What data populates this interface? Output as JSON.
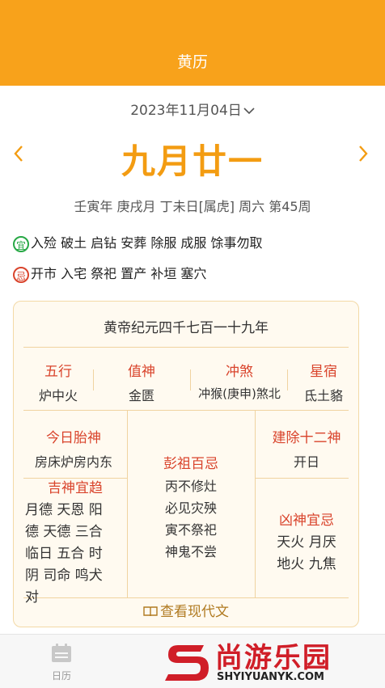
{
  "header": {
    "title": "黄历"
  },
  "date_selector": {
    "date": "2023年11月04日"
  },
  "lunar_date": "九月廿一",
  "ganzhi_line": "壬寅年 庚戌月 丁未日[属虎] 周六 第45周",
  "yi": {
    "badge": "宜",
    "text": "入殓 破土 启钻 安葬 除服 成服 馀事勿取"
  },
  "ji": {
    "badge": "忌",
    "text": "开市 入宅 祭祀 置产 补垣 塞穴"
  },
  "card": {
    "title": "黄帝纪元四千七百一十九年",
    "wuxing": {
      "label": "五行",
      "value": "炉中火"
    },
    "zhishen": {
      "label": "值神",
      "value": "金匮"
    },
    "chongsha": {
      "label": "冲煞",
      "value": "冲猴(庚申)煞北"
    },
    "xingsu": {
      "label": "星宿",
      "value": "氐土貉"
    },
    "taishen": {
      "label": "今日胎神",
      "value": "房床炉房内东"
    },
    "pengzu": {
      "label": "彭祖百忌",
      "lines": [
        "丙不修灶",
        "必见灾殃",
        "寅不祭祀",
        "神鬼不尝"
      ]
    },
    "jianchu": {
      "label": "建除十二神",
      "value": "开日"
    },
    "jishen": {
      "label": "吉神宜趋",
      "lines": [
        "月德 天恩 阳",
        "德 天德 三合",
        "临日 五合 时",
        "阴 司命 鸣犬",
        "对"
      ]
    },
    "xiongshen": {
      "label": "凶神宜忌",
      "lines": [
        "天火 月厌",
        "地火 九焦"
      ]
    },
    "modern_link": "查看现代文"
  },
  "tabbar": {
    "calendar_label": "日历"
  },
  "watermark": {
    "name": "尚游乐园",
    "url": "SHYIYUANYK.COM"
  },
  "colors": {
    "accent": "#f8a21b",
    "red": "#d9442c",
    "green": "#27a845"
  }
}
